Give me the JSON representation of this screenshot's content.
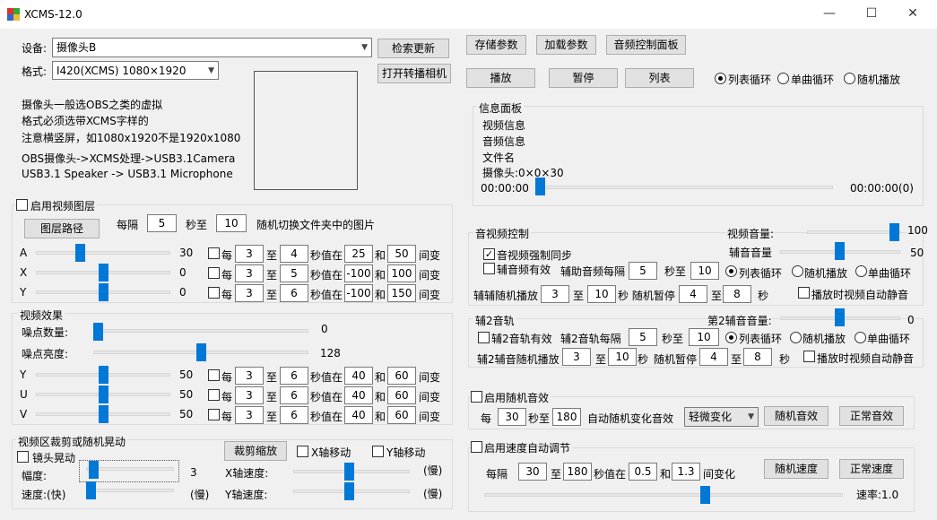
{
  "window": {
    "title": "XCMS-12.0",
    "minimize": "—",
    "maximize": "☐",
    "close": "✕"
  },
  "left": {
    "device_label": "设备:",
    "device_value": "摄像头B",
    "refresh_btn": "检索更新",
    "format_label": "格式:",
    "format_value": "I420(XCMS) 1080×1920",
    "open_cam_btn": "打开转播相机",
    "notes": [
      "摄像头一般选OBS之类的虚拟",
      "格式必须选带XCMS字样的",
      "注意横竖屏，如1080x1920不是1920x1080",
      "OBS摄像头->XCMS处理->USB3.1Camera",
      "USB3.1 Speaker -> USB3.1 Microphone"
    ]
  },
  "layer": {
    "enable": "启用视频图层",
    "path_btn": "图层路径",
    "every": "每隔",
    "every_val": "5",
    "sec_to": "秒至",
    "sec_to_val": "10",
    "rand_text": "随机切换文件夹中的图片",
    "rows": [
      {
        "name": "A",
        "val": "30",
        "pos": 0.32,
        "each": "每",
        "v1": "3",
        "to": "至",
        "v2": "4",
        "mid": "秒值在",
        "v3": "25",
        "and": "和",
        "v4": "50",
        "tail": "间变"
      },
      {
        "name": "X",
        "val": "0",
        "pos": 0.5,
        "each": "每",
        "v1": "3",
        "to": "至",
        "v2": "5",
        "mid": "秒值在",
        "v3": "-100",
        "and": "和",
        "v4": "100",
        "tail": "间变"
      },
      {
        "name": "Y",
        "val": "0",
        "pos": 0.5,
        "each": "每",
        "v1": "3",
        "to": "至",
        "v2": "6",
        "mid": "秒值在",
        "v3": "-100",
        "and": "和",
        "v4": "150",
        "tail": "间变"
      }
    ]
  },
  "video_fx": {
    "title": "视频效果",
    "noise_count": "噪点数量:",
    "noise_count_val": "0",
    "noise_count_pos": 0.0,
    "noise_bright": "噪点亮度:",
    "noise_bright_val": "128",
    "noise_bright_pos": 0.5,
    "rows": [
      {
        "name": "Y",
        "val": "50",
        "pos": 0.5,
        "each": "每",
        "v1": "3",
        "to": "至",
        "v2": "6",
        "mid": "秒值在",
        "v3": "40",
        "and": "和",
        "v4": "60",
        "tail": "间变"
      },
      {
        "name": "U",
        "val": "50",
        "pos": 0.5,
        "each": "每",
        "v1": "3",
        "to": "至",
        "v2": "6",
        "mid": "秒值在",
        "v3": "40",
        "and": "和",
        "v4": "60",
        "tail": "间变"
      },
      {
        "name": "V",
        "val": "50",
        "pos": 0.5,
        "each": "每",
        "v1": "3",
        "to": "至",
        "v2": "6",
        "mid": "秒值在",
        "v3": "40",
        "and": "和",
        "v4": "60",
        "tail": "间变"
      }
    ]
  },
  "crop": {
    "title": "视频区裁剪或随机晃动",
    "shake": "镜头晃动",
    "crop_btn": "裁剪缩放",
    "x_move": "X轴移动",
    "y_move": "Y轴移动",
    "amp": "幅度:",
    "amp_val": "3",
    "speed": "速度:(快)",
    "slow": "(慢)",
    "x_speed": "X轴速度:",
    "y_speed": "Y轴速度:",
    "slow2": "(慢)",
    "slow3": "(慢)"
  },
  "right": {
    "save_btn": "存储参数",
    "load_btn": "加载参数",
    "audio_panel_btn": "音频控制面板",
    "play_btn": "播放",
    "pause_btn": "暂停",
    "list_btn": "列表",
    "loop_list": "列表循环",
    "loop_single": "单曲循环",
    "loop_random": "随机播放",
    "info_title": "信息面板",
    "info_video": "视频信息",
    "info_audio": "音频信息",
    "info_file": "文件名",
    "info_cam": "摄像头:0×0×30",
    "time_start": "00:00:00",
    "time_end": "00:00:00(0)"
  },
  "av": {
    "title": "音视频控制",
    "video_vol": "视频音量:",
    "video_vol_val": "100",
    "aux_vol": "辅音音量",
    "aux_vol_val": "50",
    "force_sync": "音视频强制同步",
    "aux_valid": "辅音频有效",
    "aux_every": "辅助音频每隔",
    "aux_v1": "5",
    "sec_to": "秒至",
    "aux_v2": "10",
    "r_list": "列表循环",
    "r_random": "随机播放",
    "r_single": "单曲循环",
    "aux_rand": "辅辅随机播放",
    "ar_v1": "3",
    "to": "至",
    "ar_v2": "10",
    "rand_pause": "秒 随机暂停",
    "rp_v1": "4",
    "rp_to": "至",
    "rp_v2": "8",
    "sec": "秒",
    "mute": "播放时视频自动静音"
  },
  "aux2": {
    "title": "辅2音轨",
    "vol": "第2辅音音量:",
    "vol_val": "0",
    "valid": "辅2音轨有效",
    "every": "辅2音轨每隔",
    "v1": "5",
    "sec_to": "秒至",
    "v2": "10",
    "r_list": "列表循环",
    "r_random": "随机播放",
    "r_single": "单曲循环",
    "rand": "辅2辅音随机播放",
    "rv1": "3",
    "to": "至",
    "rv2": "10",
    "sec1": "秒",
    "rand_pause": "随机暂停",
    "rp1": "4",
    "rp_to": "至",
    "rp2": "8",
    "sec2": "秒",
    "mute": "播放时视频自动静音"
  },
  "rand_fx": {
    "enable": "启用随机音效",
    "every": "每",
    "v1": "30",
    "sec_to": "秒至",
    "v2": "180",
    "auto": "自动随机变化音效",
    "mode": "轻微变化",
    "rand_btn": "随机音效",
    "normal_btn": "正常音效"
  },
  "speed": {
    "enable": "启用速度自动调节",
    "every": "每隔",
    "v1": "30",
    "to": "至",
    "v2": "180",
    "mid": "秒值在",
    "v3": "0.5",
    "and": "和",
    "v4": "1.3",
    "tail": "间变化",
    "rand_btn": "随机速度",
    "normal_btn": "正常速度",
    "rate": "速率:1.0"
  }
}
